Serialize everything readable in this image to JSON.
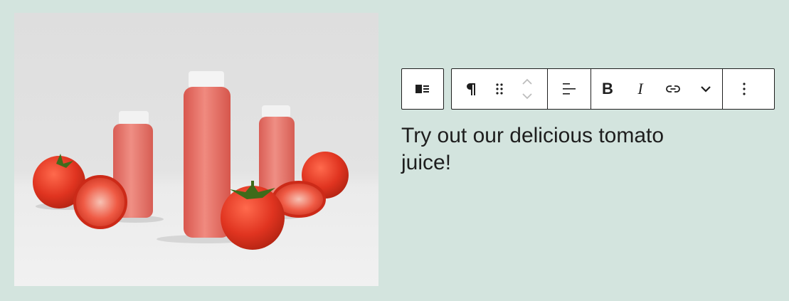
{
  "image": {
    "alt_subject": "tomato juice bottles with tomatoes",
    "icon": "photo"
  },
  "toolbar": {
    "media_text_icon": "media-text-icon",
    "paragraph_icon": "pilcrow-icon",
    "drag_icon": "drag-handle-icon",
    "move_up_icon": "chevron-up-icon",
    "move_down_icon": "chevron-down-icon",
    "align_icon": "align-left-icon",
    "bold_label": "B",
    "italic_label": "I",
    "link_icon": "link-icon",
    "more_formats_icon": "chevron-down-icon",
    "options_icon": "more-vertical-icon"
  },
  "content": {
    "paragraph_text": "Try out our delicious tomato juice!"
  },
  "colors": {
    "background": "#d3e4de",
    "toolbar_border": "#1e1e1e",
    "text": "#1e1e1e",
    "juice": "#e8736a",
    "tomato": "#e23d2a"
  }
}
